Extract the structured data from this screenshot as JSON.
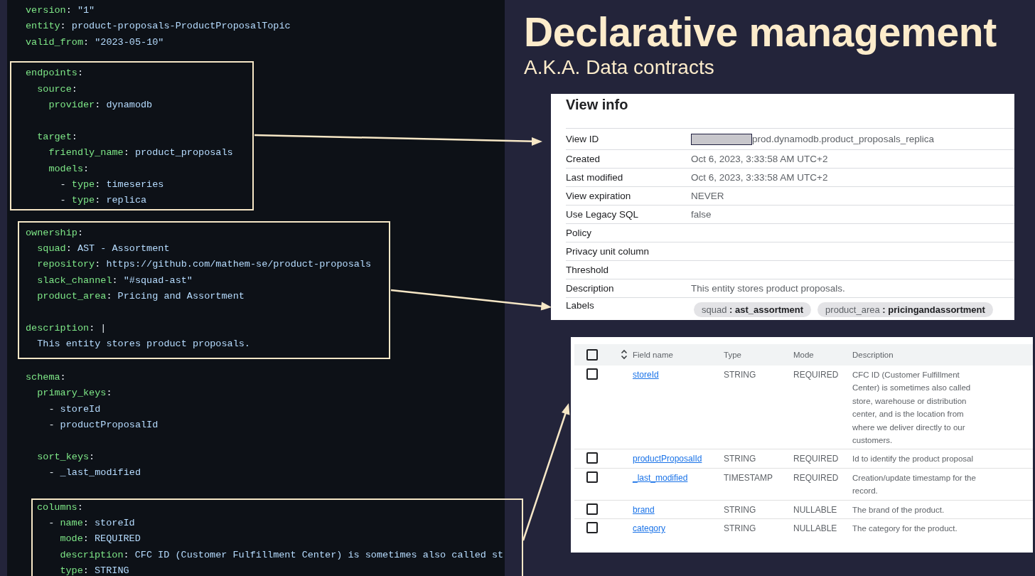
{
  "slide": {
    "title": "Declarative management",
    "subtitle": "A.K.A. Data contracts"
  },
  "code": {
    "blocks": [
      {
        "highlighted": false,
        "lines": [
          {
            "key": "version",
            "punct": ":",
            "value": "\"1\""
          },
          {
            "key": "entity",
            "punct": ":",
            "value": "product-proposals-ProductProposalTopic"
          },
          {
            "key": "valid_from",
            "punct": ":",
            "value": "\"2023-05-10\""
          }
        ]
      },
      {
        "highlighted": true,
        "lines": [
          {
            "key": "endpoints",
            "punct": ":",
            "children": [
              {
                "key": "source",
                "punct": ":",
                "children": [
                  {
                    "key": "provider",
                    "punct": ":",
                    "value": "dynamodb"
                  }
                ]
              },
              {
                "key": "target",
                "punct": ":",
                "gap_before": true,
                "children": [
                  {
                    "key": "friendly_name",
                    "punct": ":",
                    "value": "product_proposals"
                  },
                  {
                    "key": "models",
                    "punct": ":",
                    "children": [
                      {
                        "marker": "-",
                        "key": "type",
                        "punct": ":",
                        "value": "timeseries"
                      },
                      {
                        "marker": "-",
                        "key": "type",
                        "punct": ":",
                        "value": "replica"
                      }
                    ]
                  }
                ]
              }
            ]
          }
        ]
      },
      {
        "highlighted": true,
        "lines": [
          {
            "key": "ownership",
            "punct": ":",
            "children": [
              {
                "key": "squad",
                "punct": ":",
                "value": "AST - Assortment"
              },
              {
                "key": "repository",
                "punct": ":",
                "value": "https://github.com/mathem-se/product-proposals"
              },
              {
                "key": "slack_channel",
                "punct": ":",
                "value": "\"#squad-ast\""
              },
              {
                "key": "product_area",
                "punct": ":",
                "value": "Pricing and Assortment"
              }
            ]
          },
          {
            "key": "description",
            "punct": ": |",
            "gap_before": true,
            "children": [
              {
                "value": "This entity stores product proposals."
              }
            ]
          }
        ]
      },
      {
        "highlighted": false,
        "lines": [
          {
            "key": "schema",
            "punct": ":",
            "children": [
              {
                "key": "primary_keys",
                "punct": ":",
                "children": [
                  {
                    "marker": "-",
                    "value": "storeId"
                  },
                  {
                    "marker": "-",
                    "value": "productProposalId"
                  }
                ]
              },
              {
                "key": "sort_keys",
                "punct": ":",
                "gap_before": true,
                "children": [
                  {
                    "marker": "-",
                    "value": "_last_modified"
                  }
                ]
              }
            ]
          }
        ]
      },
      {
        "highlighted": true,
        "lines": [
          {
            "key": "columns",
            "punct": ":",
            "children": [
              {
                "marker": "-",
                "key": "name",
                "punct": ":",
                "value": "storeId",
                "children": [
                  {
                    "key": "mode",
                    "punct": ":",
                    "value": "REQUIRED"
                  },
                  {
                    "key": "description",
                    "punct": ":",
                    "value": "CFC ID (Customer Fulfillment Center) is sometimes also called st"
                  },
                  {
                    "key": "type",
                    "punct": ":",
                    "value": "STRING"
                  }
                ]
              }
            ]
          }
        ]
      }
    ]
  },
  "view_info": {
    "title": "View info",
    "rows": [
      {
        "kind": "redacted",
        "label": "View ID",
        "value": "prod.dynamodb.product_proposals_replica"
      },
      {
        "kind": "text",
        "label": "Created",
        "value": "Oct 6, 2023, 3:33:58 AM UTC+2"
      },
      {
        "kind": "text",
        "label": "Last modified",
        "value": "Oct 6, 2023, 3:33:58 AM UTC+2"
      },
      {
        "kind": "text",
        "label": "View expiration",
        "value": "NEVER"
      },
      {
        "kind": "text",
        "label": "Use Legacy SQL",
        "value": "false"
      },
      {
        "kind": "empty",
        "label": "Policy"
      },
      {
        "kind": "empty",
        "label": "Privacy unit column"
      },
      {
        "kind": "empty",
        "label": "Threshold"
      },
      {
        "kind": "text",
        "label": "Description",
        "value": "This entity stores product proposals."
      },
      {
        "kind": "labels",
        "label": "Labels",
        "chips": [
          "squad **: ast_assortment**",
          "product_area **: pricingandassortment**"
        ]
      }
    ]
  },
  "schema_table": {
    "header_checked": false,
    "columns": [
      "Field name",
      "Type",
      "Mode",
      "Description"
    ],
    "rows": [
      {
        "checked": false,
        "field_name": "storeId",
        "type": "STRING",
        "mode": "REQUIRED",
        "description": "CFC ID (Customer Fulfillment Center) is sometimes also called store, warehouse or distribution center, and is the location from where we deliver directly to our customers."
      },
      {
        "checked": false,
        "field_name": "productProposalId",
        "type": "STRING",
        "mode": "REQUIRED",
        "description": "Id to identify the product proposal"
      },
      {
        "checked": false,
        "field_name": "_last_modified",
        "type": "TIMESTAMP",
        "mode": "REQUIRED",
        "description": "Creation/update timestamp for the record."
      },
      {
        "checked": false,
        "field_name": "brand",
        "type": "STRING",
        "mode": "NULLABLE",
        "description": "The brand of the product."
      },
      {
        "checked": false,
        "field_name": "category",
        "type": "STRING",
        "mode": "NULLABLE",
        "description": "The category for the product."
      }
    ]
  }
}
